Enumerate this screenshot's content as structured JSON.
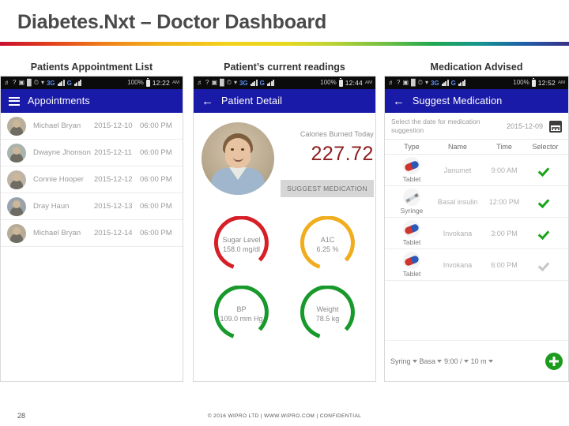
{
  "slide": {
    "title": "Diabetes.Nxt – Doctor Dashboard",
    "page_number": "28",
    "footer": "© 2016 WIPRO LTD | WWW.WIPRO.COM | CONFIDENTIAL",
    "accent_colors": {
      "appbar": "#1a1aa8",
      "calories": "#8e1c1c",
      "gauge_red": "#d61f26",
      "gauge_amber": "#f0ad1e",
      "gauge_green": "#17992b",
      "check_green": "#19a319",
      "fab_green": "#1c9b1c"
    }
  },
  "captions": {
    "col1": "Patients Appointment List",
    "col2": "Patient’s current readings",
    "col3": "Medication Advised"
  },
  "status_bar": {
    "network": "3G",
    "network2": "G",
    "battery": "100%",
    "time1": "12:22",
    "time2": "12:44",
    "time3": "12:52",
    "ampm": "AM"
  },
  "panel_appointments": {
    "title": "Appointments",
    "rows": [
      {
        "name": "Michael Bryan",
        "date": "2015-12-10",
        "time": "06:00 PM"
      },
      {
        "name": "Dwayne Jhonson",
        "date": "2015-12-11",
        "time": "06:00 PM"
      },
      {
        "name": "Connie Hooper",
        "date": "2015-12-12",
        "time": "06:00 PM"
      },
      {
        "name": "Dray Haun",
        "date": "2015-12-13",
        "time": "06:00 PM"
      },
      {
        "name": "Michael Bryan",
        "date": "2015-12-14",
        "time": "06:00 PM"
      }
    ]
  },
  "panel_patient_detail": {
    "title": "Patient Detail",
    "calories_label": "Calories Burned Today",
    "calories_value": "227.72",
    "suggest_button": "SUGGEST MEDICATION",
    "gauges": [
      {
        "label": "Sugar Level",
        "value": "158.0 mg/dl",
        "color": "#d61f26",
        "fraction": 0.72
      },
      {
        "label": "A1C",
        "value": "6.25 %",
        "color": "#f0ad1e",
        "fraction": 0.72
      },
      {
        "label": "BP",
        "value": "109.0 mm Hg",
        "color": "#17992b",
        "fraction": 0.72
      },
      {
        "label": "Weight",
        "value": "78.5 kg",
        "color": "#17992b",
        "fraction": 0.72
      }
    ]
  },
  "panel_medication": {
    "title": "Suggest Medication",
    "date_label": "Select the date for medication suggestion",
    "date_value": "2015-12-09",
    "columns": [
      "Type",
      "Name",
      "Time",
      "Selector"
    ],
    "rows": [
      {
        "type": "Tablet",
        "icon": "pill-icon",
        "name": "Janumet",
        "time": "9:00 AM",
        "selected": true
      },
      {
        "type": "Syringe",
        "icon": "syringe-icon",
        "name": "Basal insulin",
        "time": "12:00 PM",
        "selected": true
      },
      {
        "type": "Tablet",
        "icon": "pill-icon",
        "name": "Invokana",
        "time": "3:00 PM",
        "selected": true
      },
      {
        "type": "Tablet",
        "icon": "pill-icon",
        "name": "Invokana",
        "time": "6:00 PM",
        "selected": false
      }
    ],
    "controls": {
      "type_select": "Syring",
      "name_select": "Basa",
      "time_select": "9:00 /",
      "dose_select": "10 m",
      "add_button": "+"
    }
  }
}
